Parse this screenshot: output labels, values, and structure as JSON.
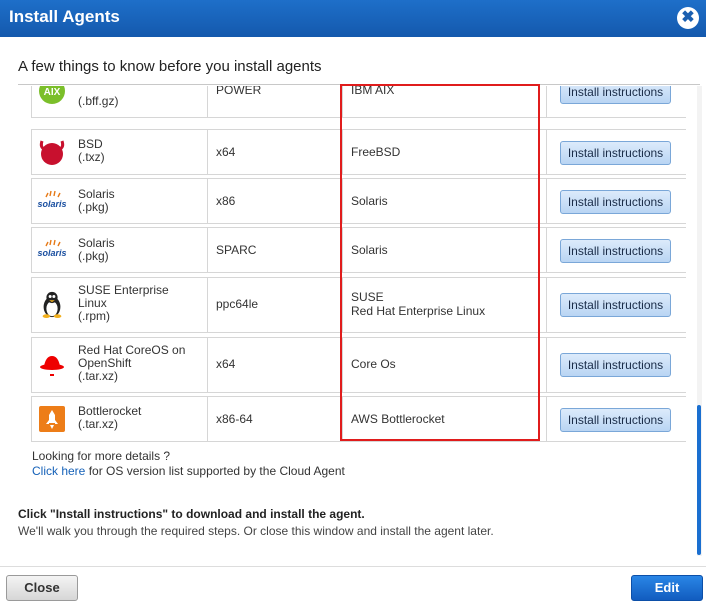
{
  "dialog": {
    "title": "Install Agents",
    "intro": "A few things to know before you install agents"
  },
  "rows": [
    {
      "name": "(.bff.gz)",
      "arch": "POWER",
      "dist": "IBM AIX",
      "button": "Install instructions",
      "icon": "aix-logo-icon",
      "logo_text": "AIX"
    },
    {
      "name": "BSD\n(.txz)",
      "arch": "x64",
      "dist": "FreeBSD",
      "button": "Install instructions",
      "icon": "freebsd-logo-icon"
    },
    {
      "name": "Solaris\n(.pkg)",
      "arch": "x86",
      "dist": "Solaris",
      "button": "Install instructions",
      "icon": "solaris-logo-icon",
      "logo_text": "solaris"
    },
    {
      "name": "Solaris\n(.pkg)",
      "arch": "SPARC",
      "dist": "Solaris",
      "button": "Install instructions",
      "icon": "solaris-logo-icon",
      "logo_text": "solaris"
    },
    {
      "name": "SUSE Enterprise\nLinux\n(.rpm)",
      "arch": "ppc64le",
      "dist": "SUSE\nRed Hat Enterprise Linux",
      "button": "Install instructions",
      "icon": "linux-tux-icon"
    },
    {
      "name": "Red Hat CoreOS on\nOpenShift\n(.tar.xz)",
      "arch": "x64",
      "dist": "Core Os",
      "button": "Install instructions",
      "icon": "redhat-logo-icon"
    },
    {
      "name": "Bottlerocket\n(.tar.xz)",
      "arch": "x86-64",
      "dist": "AWS Bottlerocket",
      "button": "Install instructions",
      "icon": "bottlerocket-logo-icon"
    }
  ],
  "more": {
    "line1": "Looking for more details ?",
    "link": "Click here",
    "line2_rest": " for OS version list supported by the Cloud Agent"
  },
  "notes": {
    "bold": "Click \"Install instructions\" to download and install the agent.",
    "normal": "We'll walk you through the required steps. Or close this window and install the agent later."
  },
  "footer": {
    "close_label": "Close",
    "edit_label": "Edit"
  },
  "colors": {
    "title_bar": "#1b64bf",
    "highlight_box": "#e01c1c",
    "link": "#1561b8"
  }
}
